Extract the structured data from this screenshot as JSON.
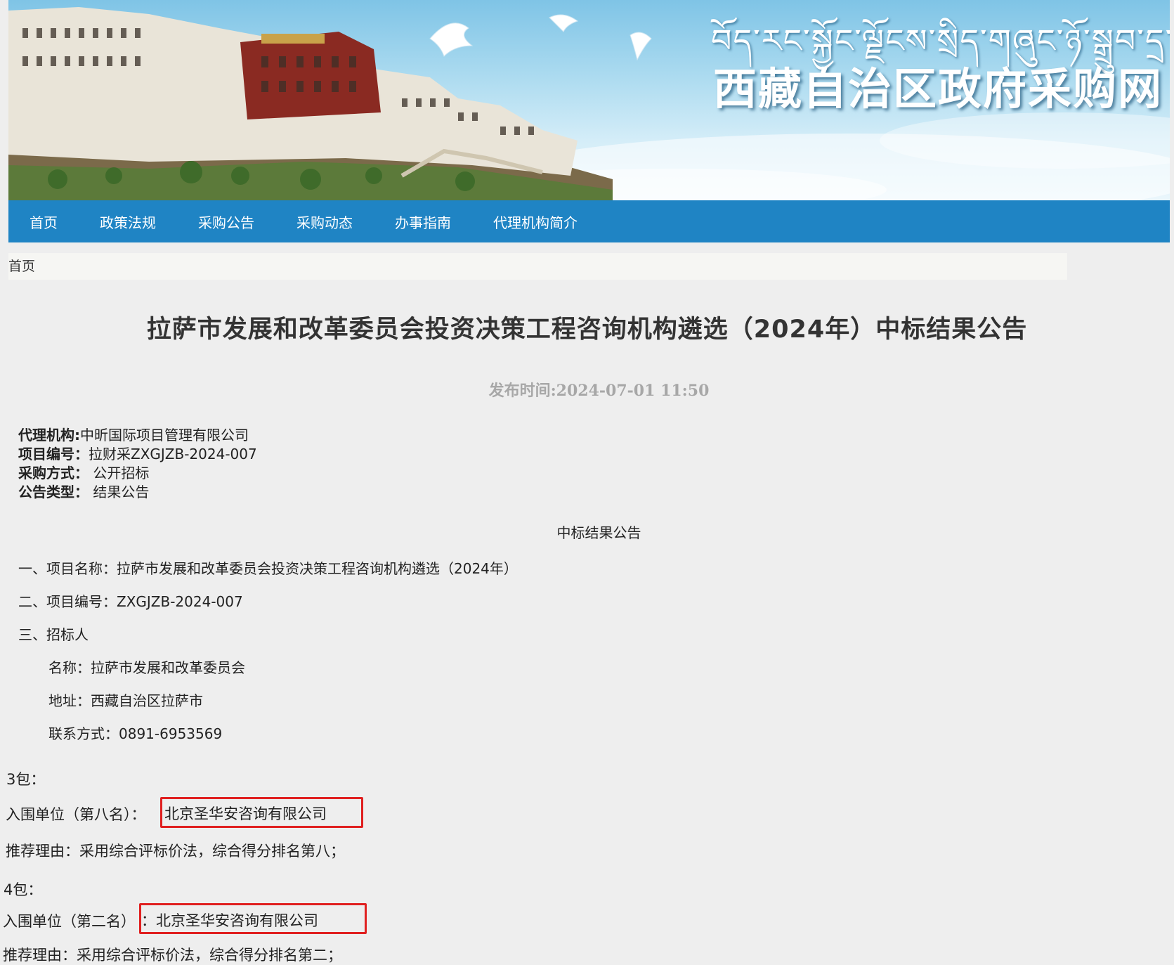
{
  "banner": {
    "tibetan_title": "བོད་རང་སྐྱོང་ལྗོངས་སྲིད་གཞུང་ཉོ་སྒྲུབ་དྲ་བ།",
    "site_title": "西藏自治区政府采购网"
  },
  "nav": {
    "items": [
      "首页",
      "政策法规",
      "采购公告",
      "采购动态",
      "办事指南",
      "代理机构简介"
    ]
  },
  "breadcrumb": {
    "home": "首页"
  },
  "article": {
    "title": "拉萨市发展和改革委员会投资决策工程咨询机构遴选（2024年）中标结果公告",
    "publish_time": "发布时间:2024-07-01  11:50",
    "meta": [
      {
        "key": "代理机构:",
        "value": "中昕国际项目管理有限公司"
      },
      {
        "key": "项目编号：",
        "value": "拉财采ZXGJZB-2024-007"
      },
      {
        "key": "采购方式：",
        "value": " 公开招标"
      },
      {
        "key": "公告类型：",
        "value": " 结果公告"
      }
    ],
    "section_title": "中标结果公告",
    "project_name": "一、项目名称：拉萨市发展和改革委员会投资决策工程咨询机构遴选（2024年）",
    "project_no": "二、项目编号：ZXGJZB-2024-007",
    "tenderer_heading": "三、招标人",
    "tenderer_name": "名称：拉萨市发展和改革委员会",
    "tenderer_address": "地址：西藏自治区拉萨市",
    "tenderer_contact": "联系方式：0891-6953569",
    "package3": {
      "label": "3包：",
      "unit_label": "入围单位（第八名）：",
      "unit_name": "北京圣华安咨询有限公司",
      "reason": "推荐理由：采用综合评标价法，综合得分排名第八；"
    },
    "package4": {
      "label": "4包：",
      "unit_label": "入围单位（第二名）",
      "unit_colon": "：",
      "unit_name": "北京圣华安咨询有限公司",
      "reason": "推荐理由：采用综合评标价法，综合得分排名第二；"
    }
  },
  "colors": {
    "nav_bg": "#1f84c4",
    "page_bg": "#eeeeee",
    "highlight": "#e02020",
    "publish_time": "#a7a7a7"
  }
}
